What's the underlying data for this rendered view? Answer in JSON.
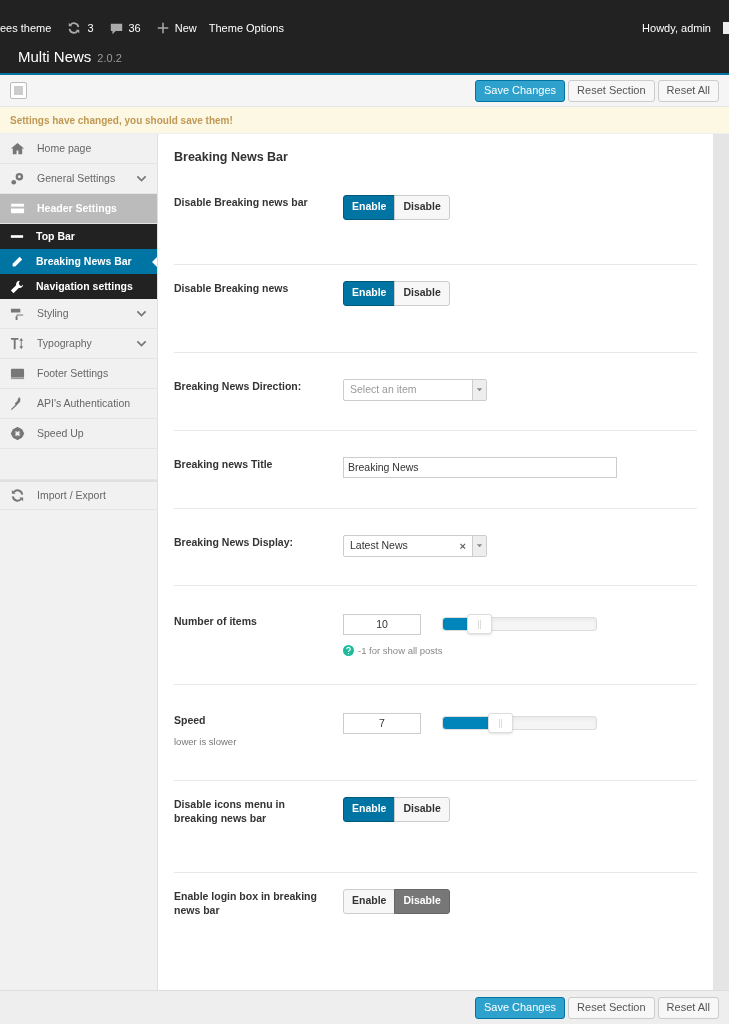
{
  "admin_bar": {
    "site": "ees theme",
    "updates": "3",
    "comments": "36",
    "new": "New",
    "theme_options": "Theme Options",
    "greeting": "Howdy, admin"
  },
  "header": {
    "title": "Multi News",
    "version": "2.0.2"
  },
  "toolbar": {
    "buttons": [
      {
        "label": "Save Changes",
        "kind": "primary"
      },
      {
        "label": "Reset Section",
        "kind": "secondary"
      },
      {
        "label": "Reset All",
        "kind": "secondary"
      }
    ]
  },
  "notice": "Settings have changed, you should save them!",
  "sidebar": {
    "items": [
      {
        "label": "Home page",
        "selected": false,
        "collapsible": false
      },
      {
        "label": "General Settings",
        "selected": false,
        "collapsible": true
      },
      {
        "label": "Header Settings",
        "selected": false,
        "collapsible": false,
        "expanded": true,
        "children": [
          {
            "label": "Top Bar",
            "selected": false
          },
          {
            "label": "Breaking News Bar",
            "selected": true
          },
          {
            "label": "Navigation settings",
            "selected": false
          }
        ]
      },
      {
        "label": "Styling",
        "selected": false,
        "collapsible": true
      },
      {
        "label": "Typography",
        "selected": false,
        "collapsible": true
      },
      {
        "label": "Footer Settings",
        "selected": false,
        "collapsible": false
      },
      {
        "label": "API's Authentication",
        "selected": false,
        "collapsible": false
      },
      {
        "label": "Speed Up",
        "selected": false,
        "collapsible": false
      },
      {
        "label": "Import / Export",
        "selected": false,
        "collapsible": false,
        "separated": true
      }
    ]
  },
  "section_title": "Breaking News Bar",
  "fields": [
    {
      "kind": "switch",
      "label": "Disable Breaking news bar",
      "options": [
        {
          "label": "Enable",
          "selected": true
        },
        {
          "label": "Disable",
          "selected": false
        }
      ]
    },
    {
      "kind": "switch",
      "label": "Disable Breaking news",
      "options": [
        {
          "label": "Enable",
          "selected": true
        },
        {
          "label": "Disable",
          "selected": false
        }
      ]
    },
    {
      "kind": "select",
      "label": "Breaking News Direction:",
      "placeholder": "Select an item"
    },
    {
      "kind": "text",
      "label": "Breaking news Title",
      "value": "Breaking News"
    },
    {
      "kind": "select",
      "label": "Breaking News Display:",
      "value": "Latest News",
      "clear": "×"
    },
    {
      "kind": "slider",
      "label": "Number of items",
      "value": "10",
      "level": 0.17,
      "hint": "-1 for show all posts"
    },
    {
      "kind": "slider",
      "label": "Speed",
      "subtitle": "lower is slower",
      "value": "7",
      "level": 0.31
    },
    {
      "kind": "switch",
      "label": "Disable icons menu in breaking news bar",
      "options": [
        {
          "label": "Enable",
          "selected": true
        },
        {
          "label": "Disable",
          "selected": false
        }
      ]
    },
    {
      "kind": "switch",
      "label": "Enable login box in breaking news bar",
      "options": [
        {
          "label": "Enable",
          "selected": false
        },
        {
          "label": "Disable",
          "selected": true
        }
      ]
    }
  ],
  "footer": {
    "buttons": [
      {
        "label": "Save Changes",
        "kind": "primary"
      },
      {
        "label": "Reset Section",
        "kind": "secondary"
      },
      {
        "label": "Reset All",
        "kind": "secondary"
      }
    ]
  }
}
